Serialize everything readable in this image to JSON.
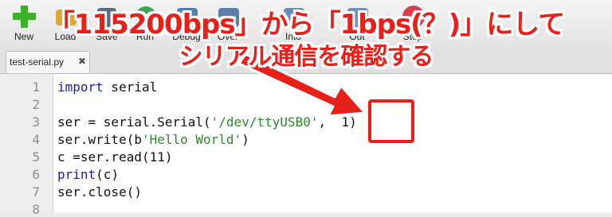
{
  "toolbar": {
    "items": [
      {
        "label": "New",
        "icon": "new-icon"
      },
      {
        "label": "Load",
        "icon": "load-icon"
      },
      {
        "label": "Save",
        "icon": "save-icon"
      },
      {
        "label": "Run",
        "icon": "run-icon"
      },
      {
        "label": "Debug",
        "icon": "debug-icon"
      },
      {
        "label": "Over",
        "icon": "step-over-icon"
      },
      {
        "label": "Into",
        "icon": "step-into-icon"
      },
      {
        "label": "Out",
        "icon": "step-out-icon"
      },
      {
        "label": "Stop",
        "icon": "stop-icon"
      }
    ]
  },
  "tab": {
    "filename": "test-serial.py",
    "close_glyph": "✖"
  },
  "editor": {
    "line_numbers": [
      "1",
      "2",
      "3",
      "4",
      "5",
      "6",
      "7",
      "8"
    ]
  },
  "annotation": {
    "headline_line1": "「115200bps」から「1bps(？)」にして",
    "headline_line2": "シリアル通信を確認する",
    "color": "#e8201a"
  },
  "colors": {
    "keyword": "#1d1db0",
    "string": "#2b8a2b",
    "add_icon": "#3fae2a"
  }
}
